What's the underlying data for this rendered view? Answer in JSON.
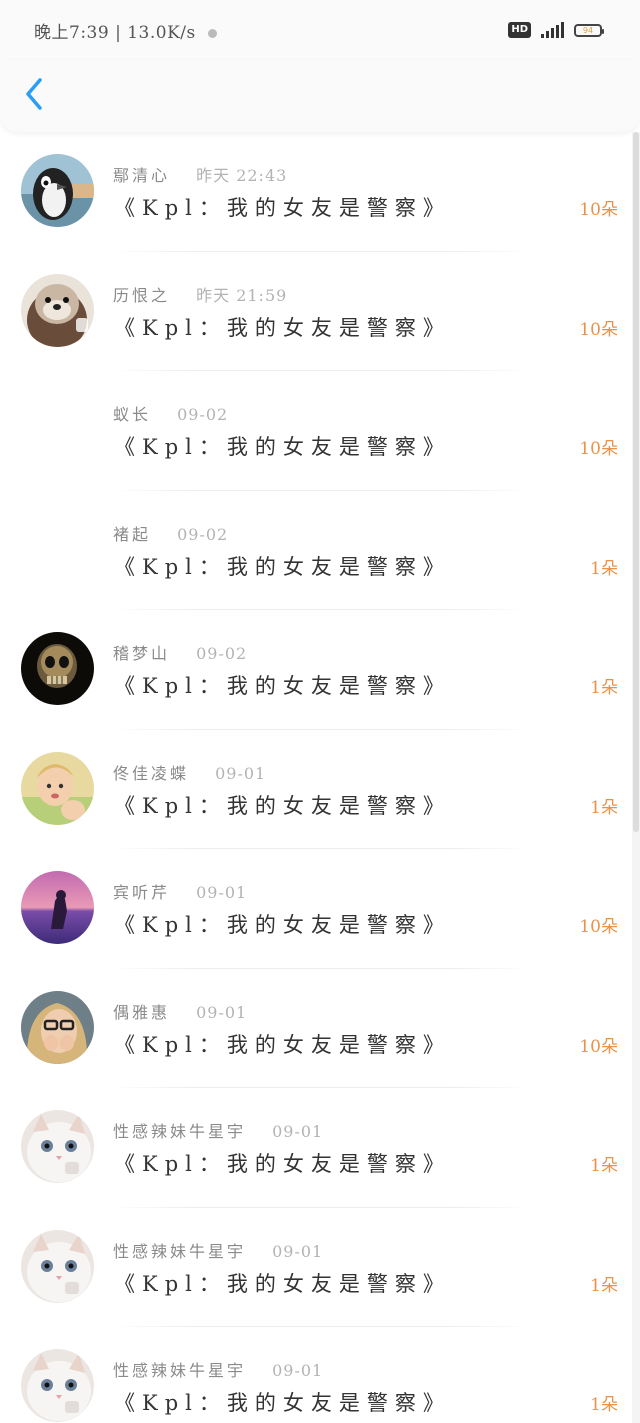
{
  "status_bar": {
    "time": "晚上7:39",
    "speed": "13.0K/s",
    "hd": "HD",
    "battery": "94"
  },
  "header": {
    "back_label": "<"
  },
  "items": [
    {
      "name": "鄢清心",
      "time": "昨天 22:43",
      "title": "《Kpl：我的女友是警察》",
      "count": "10朵",
      "avatar": "penguin-avatar"
    },
    {
      "name": "历恨之",
      "time": "昨天 21:59",
      "title": "《Kpl：我的女友是警察》",
      "count": "10朵",
      "avatar": "otter-avatar"
    },
    {
      "name": "蚁长",
      "time": "09-02",
      "title": "《Kpl：我的女友是警察》",
      "count": "10朵",
      "avatar": ""
    },
    {
      "name": "褚起",
      "time": "09-02",
      "title": "《Kpl：我的女友是警察》",
      "count": "1朵",
      "avatar": ""
    },
    {
      "name": "稽梦山",
      "time": "09-02",
      "title": "《Kpl：我的女友是警察》",
      "count": "1朵",
      "avatar": "skull-avatar"
    },
    {
      "name": "佟佳凌蝶",
      "time": "09-01",
      "title": "《Kpl：我的女友是警察》",
      "count": "1朵",
      "avatar": "child-avatar"
    },
    {
      "name": "宾听芹",
      "time": "09-01",
      "title": "《Kpl：我的女友是警察》",
      "count": "10朵",
      "avatar": "sunset-avatar"
    },
    {
      "name": "偶雅惠",
      "time": "09-01",
      "title": "《Kpl：我的女友是警察》",
      "count": "10朵",
      "avatar": "glasses-girl-avatar"
    },
    {
      "name": "性感辣妹牛星宇",
      "time": "09-01",
      "title": "《Kpl：我的女友是警察》",
      "count": "1朵",
      "avatar": "cat-avatar"
    },
    {
      "name": "性感辣妹牛星宇",
      "time": "09-01",
      "title": "《Kpl：我的女友是警察》",
      "count": "1朵",
      "avatar": "cat-avatar"
    },
    {
      "name": "性感辣妹牛星宇",
      "time": "09-01",
      "title": "《Kpl：我的女友是警察》",
      "count": "1朵",
      "avatar": "cat-avatar"
    }
  ],
  "colors": {
    "accent": "#2a9df4",
    "count": "#e8924a"
  }
}
